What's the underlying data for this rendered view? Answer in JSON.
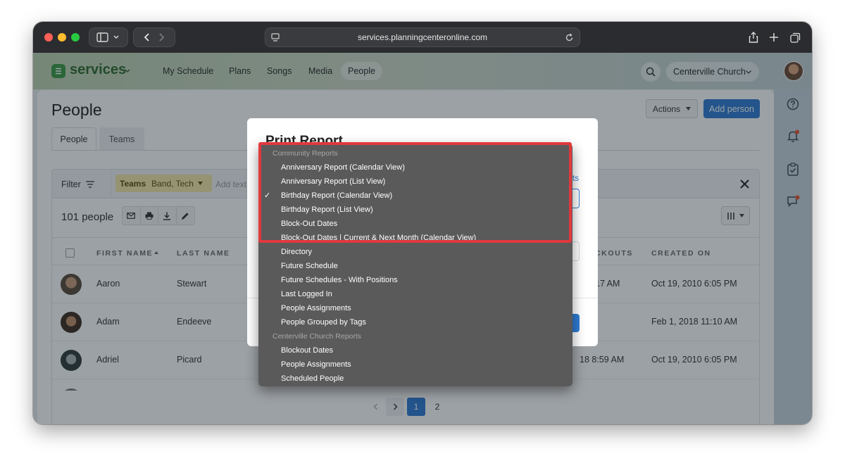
{
  "browser": {
    "url": "services.planningcenteronline.com"
  },
  "app": {
    "logo": "services",
    "nav": [
      "My Schedule",
      "Plans",
      "Songs",
      "Media",
      "People"
    ],
    "active_nav": "People",
    "org": "Centerville Church"
  },
  "page": {
    "title": "People",
    "tabs": [
      "People",
      "Teams"
    ],
    "actions_label": "Actions",
    "add_person_label": "Add person",
    "filter_label": "Filter",
    "teams_chip_key": "Teams",
    "teams_chip_value": "Band, Tech",
    "add_text_placeholder": "Add text",
    "count": "101 people"
  },
  "table": {
    "headers": [
      "FIRST NAME",
      "LAST NAME",
      "CKOUTS",
      "CREATED ON"
    ],
    "rows": [
      {
        "first": "Aaron",
        "last": "Stewart",
        "checkout": "17 AM",
        "created": "Oct 19, 2010 6:05 PM"
      },
      {
        "first": "Adam",
        "last": "Endeeve",
        "checkout": "",
        "created": "Feb 1, 2018 11:10 AM"
      },
      {
        "first": "Adriel",
        "last": "Picard",
        "checkout": "18 8:59 AM",
        "created": "Oct 19, 2010 6:05 PM"
      }
    ]
  },
  "pagination": {
    "pages": [
      "1",
      "2"
    ],
    "current": "1"
  },
  "modal": {
    "title": "Print Report",
    "link_fragment": "ts"
  },
  "dropdown": {
    "group1": "Community Reports",
    "group1_items": [
      "Anniversary Report (Calendar View)",
      "Anniversary Report (List View)",
      "Birthday Report (Calendar View)",
      "Birthday Report (List View)",
      "Block-Out Dates",
      "Block-Out Dates | Current & Next Month (Calendar View)",
      "Directory",
      "Future Schedule",
      "Future Schedules - With Positions",
      "Last Logged In",
      "People Assignments",
      "People Grouped by Tags"
    ],
    "selected": "Birthday Report (Calendar View)",
    "check": "✓",
    "group2": "Centerville Church Reports",
    "group2_items": [
      "Blockout Dates",
      "People Assignments",
      "Scheduled People"
    ]
  },
  "colors": {
    "highlight": "#e0393e",
    "primary": "#2f7bd3",
    "brand": "#3d9a45"
  }
}
